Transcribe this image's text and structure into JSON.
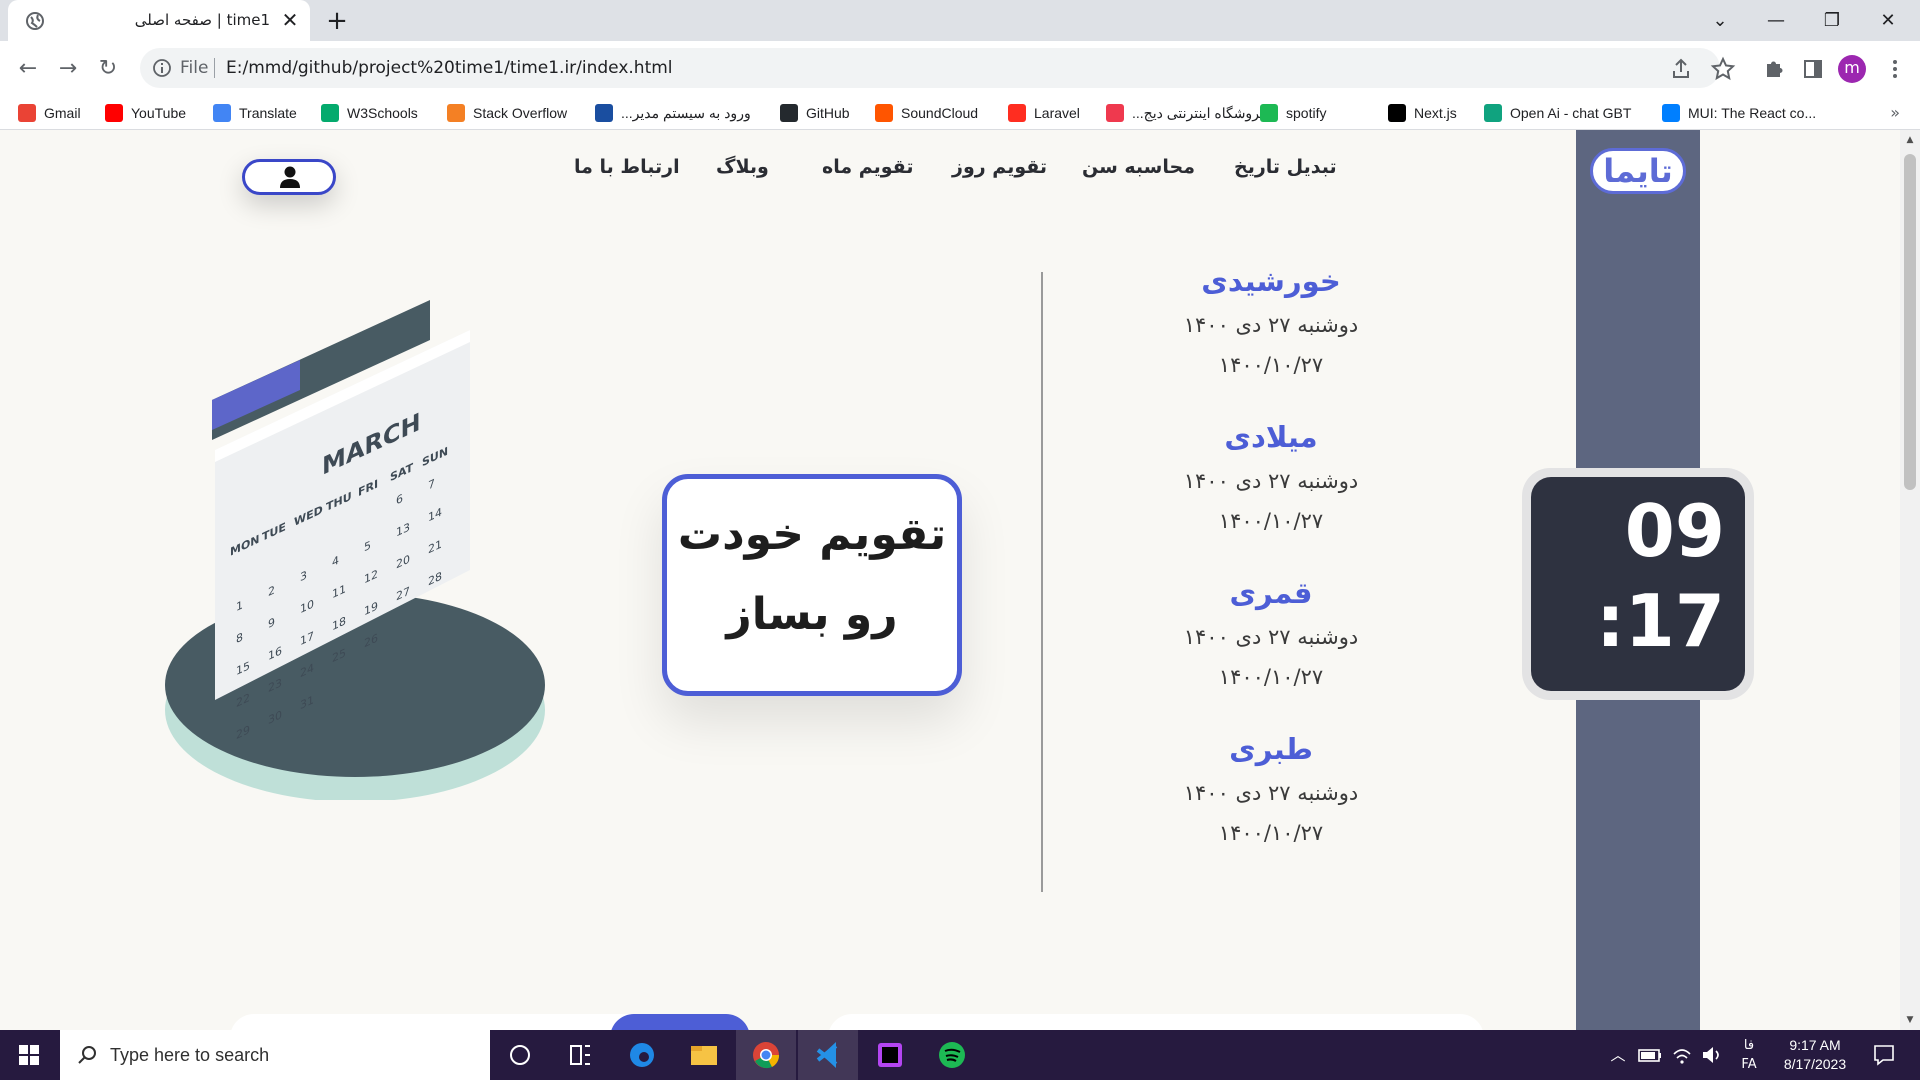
{
  "browser": {
    "tab": {
      "title": "time1 | صفحه اصلی"
    },
    "new_tab_symbol": "+",
    "window_controls": {
      "dropdown": "⌄",
      "minimize": "—",
      "restore": "❐",
      "close": "✕"
    },
    "nav": {
      "back": "←",
      "forward": "→",
      "reload": "↻"
    },
    "omnibox": {
      "scheme_label": "File",
      "url": "E:/mmd/github/project%20time1/time1.ir/index.html"
    },
    "profile_initial": "m",
    "bookmarks": [
      {
        "label": "Gmail",
        "icon": "gmail-icon",
        "color": "#ea4335"
      },
      {
        "label": "YouTube",
        "icon": "youtube-icon",
        "color": "#ff0000"
      },
      {
        "label": "Translate",
        "icon": "translate-icon",
        "color": "#4285f4"
      },
      {
        "label": "W3Schools",
        "icon": "w3schools-icon",
        "color": "#04aa6d"
      },
      {
        "label": "Stack Overflow",
        "icon": "stackoverflow-icon",
        "color": "#f48024"
      },
      {
        "label": "ورود به سیستم مدیر...",
        "icon": "admin-icon",
        "color": "#1a4ea0"
      },
      {
        "label": "GitHub",
        "icon": "github-icon",
        "color": "#24292e"
      },
      {
        "label": "SoundCloud",
        "icon": "soundcloud-icon",
        "color": "#ff5500"
      },
      {
        "label": "Laravel",
        "icon": "laravel-icon",
        "color": "#ff2d20"
      },
      {
        "label": "فروشگاه اینترنتی دیج...",
        "icon": "digikala-icon",
        "color": "#ef394e"
      },
      {
        "label": "spotify",
        "icon": "spotify-icon",
        "color": "#1db954"
      },
      {
        "label": "Next.js",
        "icon": "nextjs-icon",
        "color": "#000000"
      },
      {
        "label": "Open Ai - chat GBT",
        "icon": "openai-icon",
        "color": "#10a37f"
      },
      {
        "label": "MUI: The React co...",
        "icon": "mui-icon",
        "color": "#007fff"
      }
    ],
    "more_bookmarks": "»"
  },
  "page": {
    "logo_text": "تایما",
    "nav": [
      {
        "label": "تبدیل تاریخ"
      },
      {
        "label": "محاسبه سن"
      },
      {
        "label": "تقویم روز"
      },
      {
        "label": "تقویم ماه"
      },
      {
        "label": "وبلاگ"
      },
      {
        "label": "ارتباط با ما"
      }
    ],
    "calendars": [
      {
        "title": "خورشیدی",
        "line1": "دوشنبه ۲۷ دی ۱۴۰۰",
        "line2": "۱۴۰۰/۱۰/۲۷"
      },
      {
        "title": "میلادی",
        "line1": "دوشنبه ۲۷ دی ۱۴۰۰",
        "line2": "۱۴۰۰/۱۰/۲۷"
      },
      {
        "title": "قمری",
        "line1": "دوشنبه ۲۷ دی ۱۴۰۰",
        "line2": "۱۴۰۰/۱۰/۲۷"
      },
      {
        "title": "طبری",
        "line1": "دوشنبه ۲۷ دی ۱۴۰۰",
        "line2": "۱۴۰۰/۱۰/۲۷"
      }
    ],
    "promo": {
      "line1": "تقویم خودت",
      "line2": "رو بساز"
    },
    "clock": {
      "hours": "09",
      "minutes": ":17"
    },
    "illustration": {
      "month": "MARCH",
      "weekdays": [
        "MON",
        "TUE",
        "WED",
        "THU",
        "FRI",
        "SAT",
        "SUN"
      ],
      "weeks": [
        [
          "",
          "",
          "",
          "",
          "",
          "6",
          "7"
        ],
        [
          "1",
          "2",
          "3",
          "4",
          "5",
          "13",
          "14"
        ],
        [
          "8",
          "9",
          "10",
          "11",
          "12",
          "20",
          "21"
        ],
        [
          "15",
          "16",
          "17",
          "18",
          "19",
          "27",
          "28"
        ],
        [
          "22",
          "23",
          "24",
          "25",
          "26",
          "",
          ""
        ],
        [
          "29",
          "30",
          "31",
          "",
          "",
          "",
          ""
        ]
      ]
    }
  },
  "taskbar": {
    "search_placeholder": "Type here to search",
    "lang_top": "فا",
    "lang_bottom": "FA",
    "time": "9:17 AM",
    "date": "8/17/2023"
  }
}
